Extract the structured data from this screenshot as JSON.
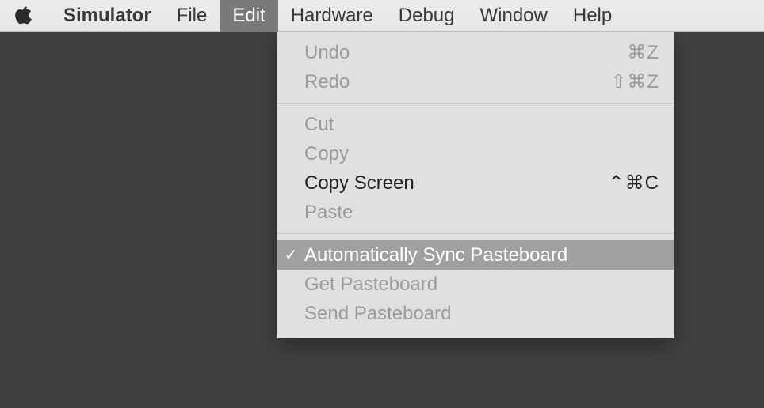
{
  "menubar": {
    "app_name": "Simulator",
    "items": [
      {
        "label": "File"
      },
      {
        "label": "Edit",
        "open": true
      },
      {
        "label": "Hardware"
      },
      {
        "label": "Debug"
      },
      {
        "label": "Window"
      },
      {
        "label": "Help"
      }
    ]
  },
  "edit_menu": {
    "groups": [
      [
        {
          "label": "Undo",
          "shortcut": "⌘Z",
          "enabled": false
        },
        {
          "label": "Redo",
          "shortcut": "⇧⌘Z",
          "enabled": false
        }
      ],
      [
        {
          "label": "Cut",
          "shortcut": "",
          "enabled": false
        },
        {
          "label": "Copy",
          "shortcut": "",
          "enabled": false
        },
        {
          "label": "Copy Screen",
          "shortcut": "⌃⌘C",
          "enabled": true
        },
        {
          "label": "Paste",
          "shortcut": "",
          "enabled": false
        }
      ],
      [
        {
          "label": "Automatically Sync Pasteboard",
          "shortcut": "",
          "enabled": true,
          "checked": true,
          "highlight": true
        },
        {
          "label": "Get Pasteboard",
          "shortcut": "",
          "enabled": false
        },
        {
          "label": "Send Pasteboard",
          "shortcut": "",
          "enabled": false
        }
      ]
    ]
  }
}
